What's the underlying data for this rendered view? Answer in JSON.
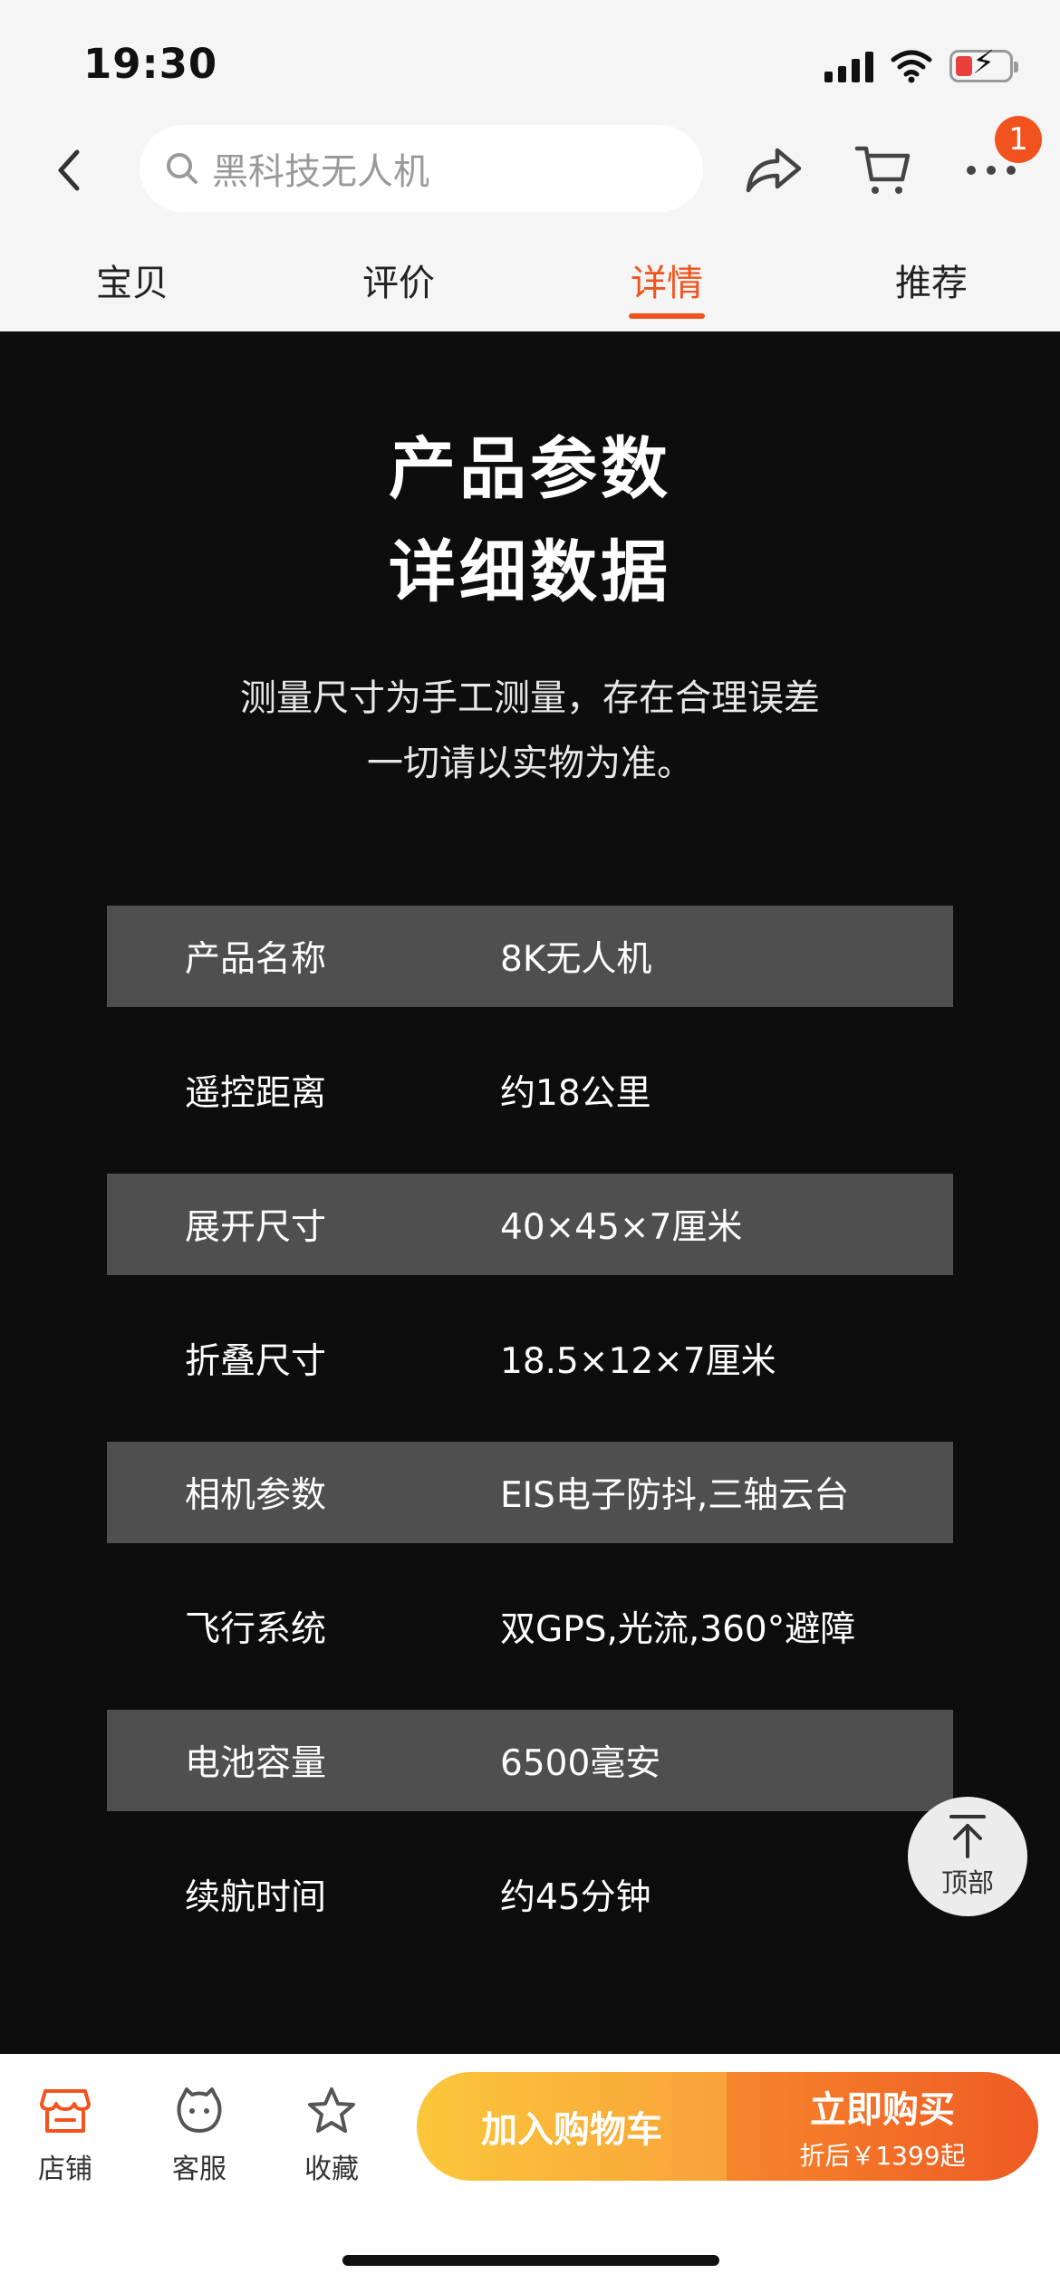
{
  "status_bar": {
    "time": "19:30"
  },
  "search": {
    "placeholder": "黑科技无人机"
  },
  "header": {
    "cart_badge": "1"
  },
  "tabs": [
    {
      "label": "宝贝",
      "active": false
    },
    {
      "label": "评价",
      "active": false
    },
    {
      "label": "详情",
      "active": true
    },
    {
      "label": "推荐",
      "active": false
    }
  ],
  "detail": {
    "title_line1": "产品参数",
    "title_line2": "详细数据",
    "note_line1": "测量尺寸为手工测量，存在合理误差",
    "note_line2": "一切请以实物为准。",
    "specs": [
      {
        "label": "产品名称",
        "value": "8K无人机"
      },
      {
        "label": "遥控距离",
        "value": "约18公里"
      },
      {
        "label": "展开尺寸",
        "value": "40×45×7厘米"
      },
      {
        "label": "折叠尺寸",
        "value": "18.5×12×7厘米"
      },
      {
        "label": "相机参数",
        "value": "EIS电子防抖,三轴云台"
      },
      {
        "label": "飞行系统",
        "value": "双GPS,光流,360°避障"
      },
      {
        "label": "电池容量",
        "value": "6500毫安"
      },
      {
        "label": "续航时间",
        "value": "约45分钟"
      }
    ]
  },
  "back_to_top": {
    "label": "顶部"
  },
  "bottom_bar": {
    "shop_label": "店铺",
    "service_label": "客服",
    "favorite_label": "收藏",
    "add_to_cart_label": "加入购物车",
    "buy_now_label": "立即购买",
    "buy_now_price": "折后￥1399起"
  },
  "colors": {
    "accent": "#f2531e",
    "cart_button": "#fbc73a",
    "buy_button": "#ee5a23",
    "detail_background": "#0d0d0d",
    "spec_row_shade": "#4f4f4f"
  }
}
